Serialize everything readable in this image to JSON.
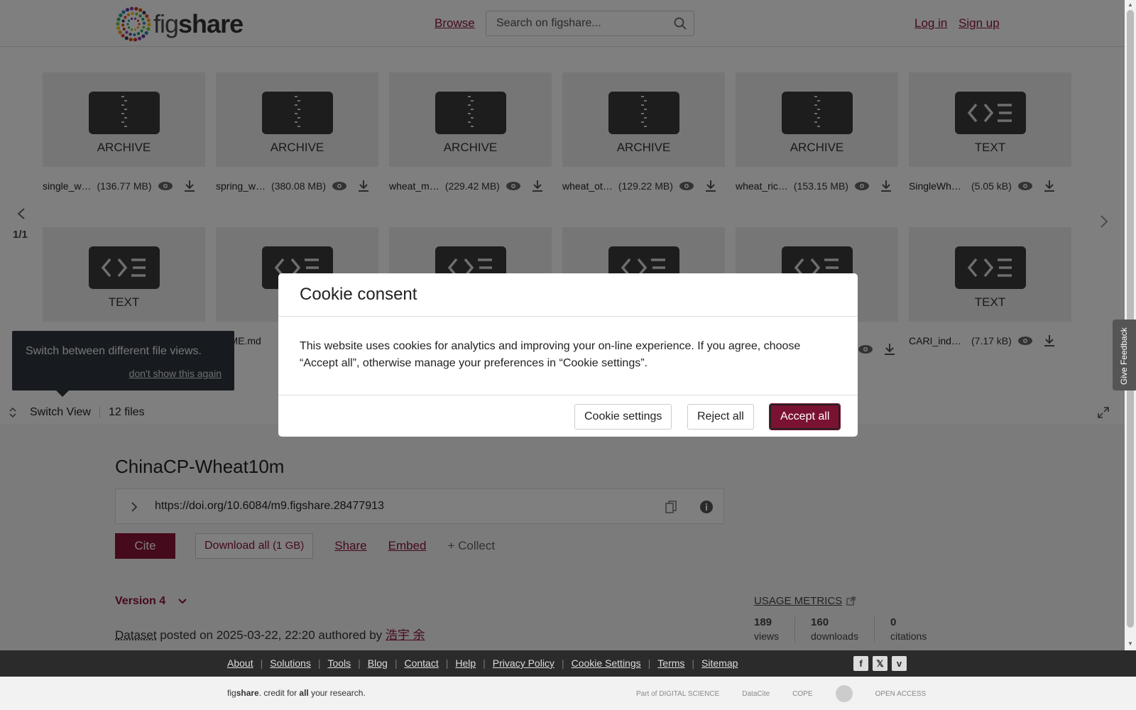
{
  "header": {
    "logo_text_light": "fig",
    "logo_text_bold": "share",
    "browse": "Browse",
    "search_placeholder": "Search on figshare...",
    "login": "Log in",
    "signup": "Sign up"
  },
  "files": {
    "row1": [
      {
        "type": "ARCHIVE",
        "icon": "archive-icon",
        "name": "single_w…",
        "size": "(136.77 MB)"
      },
      {
        "type": "ARCHIVE",
        "icon": "archive-icon",
        "name": "spring_w…",
        "size": "(380.08 MB)"
      },
      {
        "type": "ARCHIVE",
        "icon": "archive-icon",
        "name": "wheat_m…",
        "size": "(229.42 MB)"
      },
      {
        "type": "ARCHIVE",
        "icon": "archive-icon",
        "name": "wheat_ot…",
        "size": "(129.22 MB)"
      },
      {
        "type": "ARCHIVE",
        "icon": "archive-icon",
        "name": "wheat_ric…",
        "size": "(153.15 MB)"
      },
      {
        "type": "TEXT",
        "icon": "code-text-icon",
        "name": "SingleWheat…",
        "size": "(5.05 kB)"
      }
    ],
    "row2": [
      {
        "type": "TEXT",
        "icon": "code-text-icon",
        "name": "",
        "size": ""
      },
      {
        "type": "",
        "icon": "code-text-icon",
        "name": "ADME.md",
        "size": ""
      },
      {
        "type": "",
        "icon": "code-text-icon",
        "name": "",
        "size": ""
      },
      {
        "type": "",
        "icon": "code-text-icon",
        "name": "",
        "size": ""
      },
      {
        "type": "",
        "icon": "code-text-icon",
        "name": "",
        "size": ""
      },
      {
        "type": "TEXT",
        "icon": "code-text-icon",
        "name": "CARI_index.txt",
        "size": "(7.17 kB)"
      }
    ],
    "page_indicator": "1/1",
    "switch_view": "Switch View",
    "file_count": "12 files"
  },
  "tooltip": {
    "text": "Switch between different file views.",
    "dont_show": "don't show this again"
  },
  "dataset": {
    "title": "ChinaCP-Wheat10m",
    "doi": "https://doi.org/10.6084/m9.figshare.28477913",
    "cite": "Cite",
    "download_label": "Download all",
    "download_size": "(1 GB)",
    "share": "Share",
    "embed": "Embed",
    "collect": "+ Collect",
    "version": "Version 4",
    "posted_type": "Dataset",
    "posted_text": " posted on 2025-03-22, 22:20 authored by ",
    "author": "浩宇 余",
    "usage_metrics": "USAGE METRICS",
    "metrics": [
      {
        "value": "189",
        "label": "views"
      },
      {
        "value": "160",
        "label": "downloads"
      },
      {
        "value": "0",
        "label": "citations"
      }
    ]
  },
  "cookie": {
    "title": "Cookie consent",
    "body": "This website uses cookies for analytics and improving your on-line experience. If you agree, choose “Accept all”, otherwise manage your preferences in “Cookie settings”.",
    "settings": "Cookie settings",
    "reject": "Reject all",
    "accept": "Accept all"
  },
  "feedback": "Give Feedback",
  "footer": {
    "links": [
      "About",
      "Solutions",
      "Tools",
      "Blog",
      "Contact",
      "Help",
      "Privacy Policy",
      "Cookie Settings",
      "Terms",
      "Sitemap"
    ],
    "tagline_brand_light": "fig",
    "tagline_brand_bold": "share",
    "tagline_rest_1": ". credit for ",
    "tagline_bold": "all",
    "tagline_rest_2": " your research.",
    "partners": [
      "Part of DIGITAL SCIENCE",
      "DataCite",
      "COPE",
      "",
      "OPEN ACCESS"
    ],
    "social": [
      "facebook-icon",
      "x-icon",
      "vimeo-icon"
    ]
  },
  "colors": {
    "brand": "#8a1537",
    "accept_button": "#7a1232",
    "tooltip_bg": "#2f3640",
    "footer_dark": "#2b2b2b"
  }
}
